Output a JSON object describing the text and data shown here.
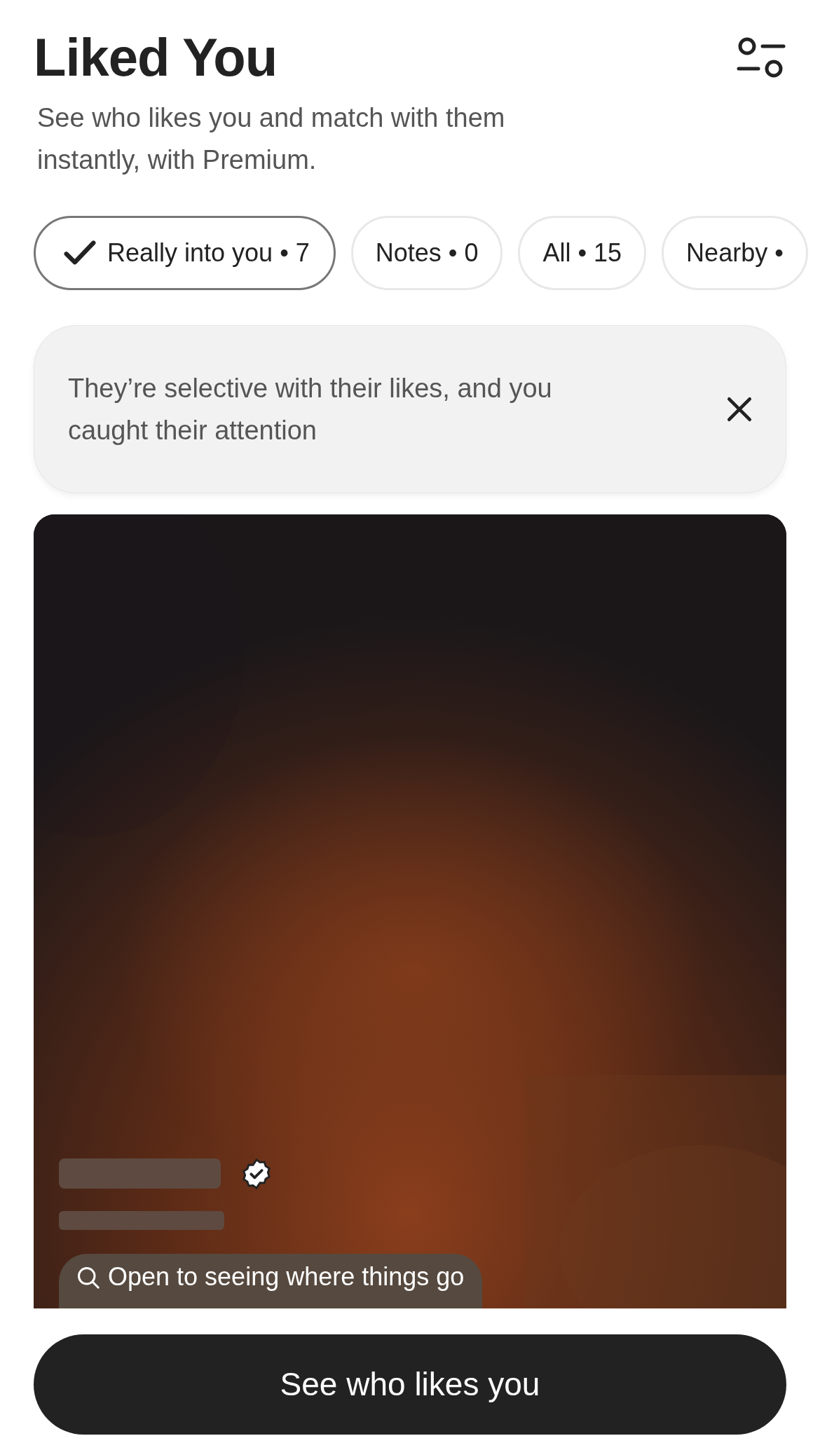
{
  "header": {
    "title": "Liked You",
    "subtitle": "See who likes you and match with them instantly, with Premium."
  },
  "filters": [
    {
      "label": "Really into you • 7",
      "selected": true
    },
    {
      "label": "Notes • 0",
      "selected": false
    },
    {
      "label": "All • 15",
      "selected": false
    },
    {
      "label": "Nearby •",
      "selected": false
    }
  ],
  "banner": {
    "text": "They’re selective with their likes, and you caught their attention"
  },
  "profile_card": {
    "verified": true,
    "prompt": "Open to seeing where things go"
  },
  "primary_button": "See who likes you"
}
